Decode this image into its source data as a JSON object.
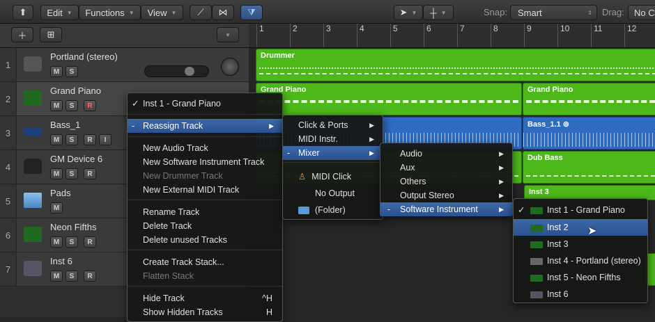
{
  "toolbar": {
    "edit": "Edit",
    "functions": "Functions",
    "view": "View",
    "snap_label": "Snap:",
    "snap_value": "Smart",
    "drag_label": "Drag:",
    "drag_value": "No C"
  },
  "ruler": {
    "bars": [
      "1",
      "2",
      "3",
      "4",
      "5",
      "6",
      "7",
      "8",
      "9",
      "10",
      "11",
      "12"
    ]
  },
  "tracks": [
    {
      "num": "1",
      "name": "Portland (stereo)",
      "buttons": [
        "M",
        "S"
      ]
    },
    {
      "num": "2",
      "name": "Grand Piano",
      "buttons": [
        "M",
        "S",
        "R"
      ]
    },
    {
      "num": "3",
      "name": "Bass_1",
      "buttons": [
        "M",
        "S",
        "R",
        "I"
      ]
    },
    {
      "num": "4",
      "name": "GM Device 6",
      "buttons": [
        "M",
        "S",
        "R"
      ]
    },
    {
      "num": "5",
      "name": "Pads",
      "buttons": [
        "M"
      ]
    },
    {
      "num": "6",
      "name": "Neon Fifths",
      "buttons": [
        "M",
        "S",
        "R"
      ]
    },
    {
      "num": "7",
      "name": "Inst 6",
      "buttons": [
        "M",
        "S",
        "R"
      ]
    }
  ],
  "regions": {
    "drummer": "Drummer",
    "piano1": "Grand Piano",
    "piano2": "Grand Piano",
    "bass": "Bass_1.1",
    "dub": "Dub Bass",
    "inst3": "Inst 3"
  },
  "context_menu": {
    "current": "Inst 1 - Grand Piano",
    "reassign": "Reassign Track",
    "new_audio": "New Audio Track",
    "new_sw": "New Software Instrument Track",
    "new_drummer": "New Drummer Track",
    "new_ext": "New External MIDI Track",
    "rename": "Rename Track",
    "delete": "Delete Track",
    "delete_unused": "Delete unused Tracks",
    "create_stack": "Create Track Stack...",
    "flatten": "Flatten Stack",
    "hide": "Hide Track",
    "hide_sc": "^H",
    "show_hidden": "Show Hidden Tracks",
    "show_sc": "H"
  },
  "submenu1": {
    "click_ports": "Click & Ports",
    "midi_instr": "MIDI Instr.",
    "mixer": "Mixer",
    "midi_click": "MIDI Click",
    "no_output": "No Output",
    "folder": "(Folder)"
  },
  "submenu2": {
    "audio": "Audio",
    "aux": "Aux",
    "others": "Others",
    "output_stereo": "Output Stereo",
    "software_instrument": "Software Instrument"
  },
  "submenu3": {
    "items": [
      "Inst 1 - Grand Piano",
      "Inst 2",
      "Inst 3",
      "Inst 4 - Portland (stereo)",
      "Inst 5 - Neon Fifths",
      "Inst 6"
    ],
    "checked": "Inst 1 - Grand Piano",
    "highlighted": "Inst 2"
  },
  "colors": {
    "midi_region": "#4cb81a",
    "audio_region": "#2f6bbf",
    "highlight": "#2a5090"
  }
}
